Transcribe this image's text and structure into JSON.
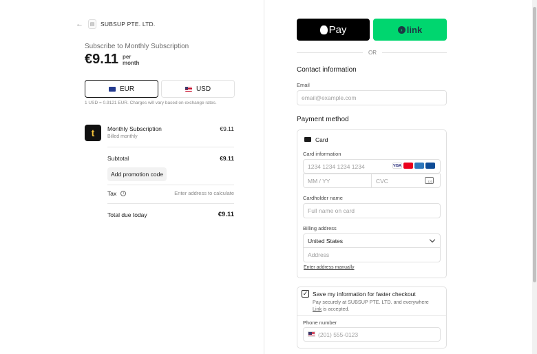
{
  "merchant": {
    "name": "SUBSUP PTE. LTD."
  },
  "summary": {
    "title": "Subscribe to Monthly Subscription",
    "price": "€9.11",
    "period_1": "per",
    "period_2": "month",
    "currencies": [
      {
        "code": "EUR",
        "selected": true
      },
      {
        "code": "USD",
        "selected": false
      }
    ],
    "rate_note": "1 USD = 0.9121 EUR. Charges will vary based on exchange rates.",
    "item": {
      "icon_letter": "t",
      "name": "Monthly Subscription",
      "billing": "Billed monthly",
      "price": "€9.11"
    },
    "subtotal_label": "Subtotal",
    "subtotal_value": "€9.11",
    "promo_label": "Add promotion code",
    "tax_label": "Tax",
    "tax_value": "Enter address to calculate",
    "total_label": "Total due today",
    "total_value": "€9.11"
  },
  "checkout": {
    "apple_pay_label": "Pay",
    "link_label": "link",
    "or_label": "OR",
    "contact_title": "Contact information",
    "email_label": "Email",
    "email_placeholder": "email@example.com",
    "payment_title": "Payment method",
    "card_label": "Card",
    "card_info_label": "Card information",
    "card_number_placeholder": "1234 1234 1234 1234",
    "expiry_placeholder": "MM / YY",
    "cvc_placeholder": "CVC",
    "cvc_icon_text": "123",
    "brands": [
      "VISA",
      "MC",
      "AMEX",
      "JCB"
    ],
    "cardholder_label": "Cardholder name",
    "cardholder_placeholder": "Full name on card",
    "billing_label": "Billing address",
    "country_value": "United States",
    "address_placeholder": "Address",
    "manual_label": "Enter address manually",
    "save_title": "Save my information for faster checkout",
    "save_desc_1": "Pay securely at SUBSUP PTE. LTD. and everywhere",
    "save_desc_link": "Link",
    "save_desc_2": "is accepted.",
    "phone_label": "Phone number",
    "phone_placeholder": "(201) 555-0123"
  },
  "colors": {
    "link_green": "#00d66f",
    "link_dark": "#1d3944"
  }
}
